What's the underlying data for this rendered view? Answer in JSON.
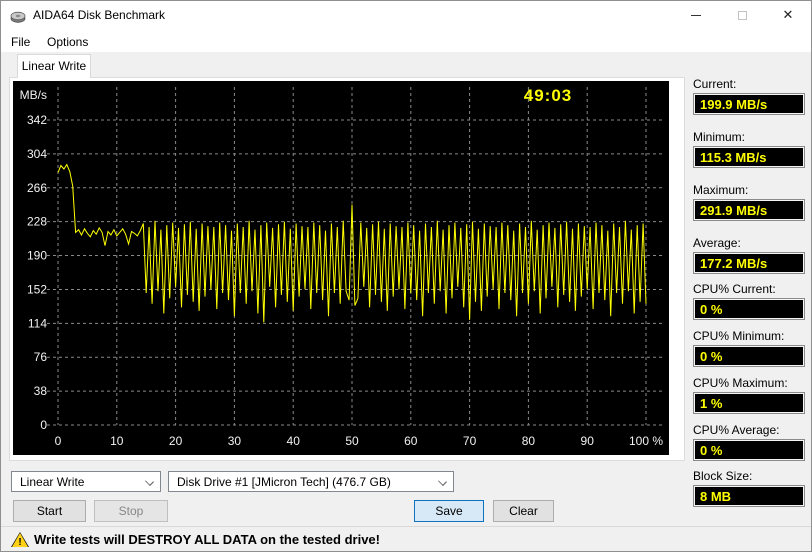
{
  "window": {
    "title": "AIDA64 Disk Benchmark"
  },
  "menu": {
    "items": [
      {
        "label": "File"
      },
      {
        "label": "Options"
      }
    ]
  },
  "tab": {
    "label": "Linear Write"
  },
  "colors": {
    "accent_yellow": "#ffff00",
    "chart_bg": "#000000",
    "grid": "#8a8a8a",
    "tick_text": "#f2f2f2",
    "save_accent": "#0f72bd",
    "warning_yellow": "#ffd117"
  },
  "chart_data": {
    "type": "line",
    "title": "Linear Write benchmark trace",
    "ylabel": "MB/s",
    "xlabel": "",
    "elapsed_time": "49:03",
    "ylim": [
      0,
      386
    ],
    "xlim": [
      0,
      100
    ],
    "grid": "dashed",
    "y_ticks": [
      342,
      304,
      266,
      228,
      190,
      152,
      114,
      76,
      38,
      0
    ],
    "x_ticks": [
      "0",
      "10",
      "20",
      "30",
      "40",
      "50",
      "60",
      "70",
      "80",
      "90",
      "100 %"
    ],
    "series": [
      {
        "name": "Linear Write",
        "color": "#ffff00",
        "x_step": 0.5,
        "values": [
          283,
          291,
          287,
          292,
          284,
          268,
          216,
          219,
          213,
          220,
          215,
          211,
          218,
          214,
          221,
          216,
          201,
          217,
          213,
          219,
          212,
          216,
          220,
          214,
          203,
          217,
          215,
          212,
          218,
          226,
          148,
          222,
          136,
          229,
          150,
          219,
          125,
          224,
          142,
          227,
          155,
          221,
          132,
          225,
          146,
          228,
          138,
          220,
          128,
          226,
          144,
          223,
          152,
          222,
          130,
          227,
          148,
          224,
          140,
          218,
          122,
          226,
          148,
          222,
          136,
          229,
          150,
          219,
          125,
          224,
          115,
          227,
          155,
          221,
          132,
          225,
          146,
          228,
          138,
          220,
          128,
          226,
          144,
          223,
          152,
          222,
          130,
          227,
          148,
          224,
          140,
          218,
          122,
          226,
          148,
          222,
          136,
          229,
          150,
          140,
          247,
          134,
          142,
          227,
          155,
          221,
          132,
          225,
          146,
          228,
          138,
          220,
          128,
          226,
          144,
          223,
          152,
          222,
          130,
          227,
          148,
          224,
          140,
          218,
          122,
          226,
          148,
          222,
          136,
          229,
          150,
          219,
          125,
          224,
          142,
          227,
          155,
          221,
          132,
          225,
          118,
          228,
          138,
          220,
          128,
          226,
          144,
          223,
          152,
          222,
          130,
          227,
          148,
          224,
          140,
          218,
          122,
          226,
          148,
          222,
          136,
          229,
          150,
          219,
          125,
          224,
          142,
          227,
          155,
          221,
          132,
          225,
          146,
          228,
          138,
          220,
          128,
          226,
          144,
          223,
          152,
          222,
          130,
          227,
          148,
          224,
          140,
          218,
          122,
          226,
          148,
          222,
          136,
          229,
          150,
          219,
          125,
          224,
          138,
          226,
          136
        ]
      }
    ]
  },
  "stats": [
    {
      "label": "Current:",
      "value": "199.9 MB/s"
    },
    {
      "label": "Minimum:",
      "value": "115.3 MB/s"
    },
    {
      "label": "Maximum:",
      "value": "291.9 MB/s"
    },
    {
      "label": "Average:",
      "value": "177.2 MB/s"
    },
    {
      "label": "CPU% Current:",
      "value": "0 %"
    },
    {
      "label": "CPU% Minimum:",
      "value": "0 %"
    },
    {
      "label": "CPU% Maximum:",
      "value": "1 %"
    },
    {
      "label": "CPU% Average:",
      "value": "0 %"
    },
    {
      "label": "Block Size:",
      "value": "8 MB"
    }
  ],
  "controls": {
    "test_select": "Linear Write",
    "drive_select": "Disk Drive #1  [JMicron Tech]  (476.7 GB)",
    "start_label": "Start",
    "stop_label": "Stop",
    "save_label": "Save",
    "clear_label": "Clear"
  },
  "status_bar": {
    "warning_glyph": "!",
    "message": "Write tests will DESTROY ALL DATA on the tested drive!"
  }
}
